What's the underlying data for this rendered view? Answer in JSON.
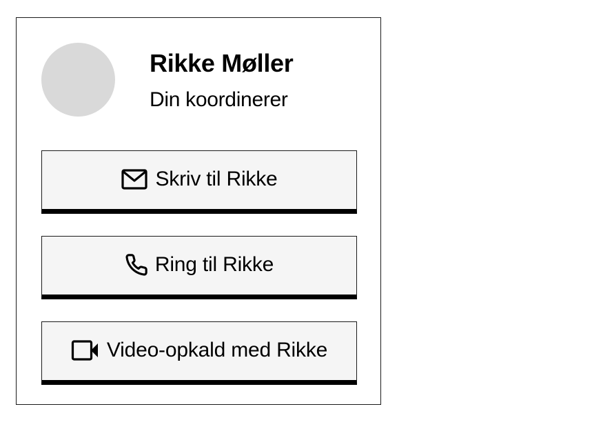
{
  "contact": {
    "name": "Rikke Møller",
    "role": "Din koordinerer"
  },
  "actions": [
    {
      "label": "Skriv til Rikke",
      "icon": "mail-icon"
    },
    {
      "label": "Ring til Rikke",
      "icon": "phone-icon"
    },
    {
      "label": "Video-opkald med Rikke",
      "icon": "video-camera-icon"
    }
  ],
  "colors": {
    "avatar_placeholder": "#d9d9d9",
    "button_background": "#f5f5f5",
    "border": "#1a1a1a"
  }
}
